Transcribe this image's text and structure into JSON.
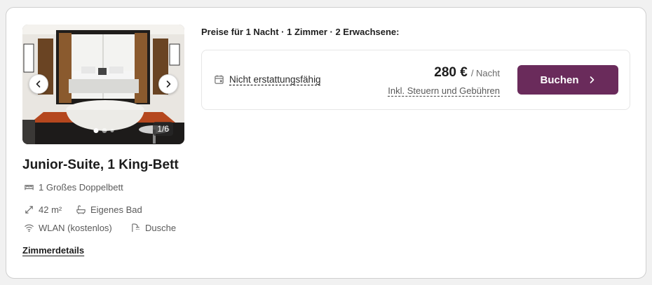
{
  "room": {
    "title": "Junior-Suite, 1 King-Bett",
    "bed": "1 Großes Doppelbett",
    "size": "42 m²",
    "bath": "Eigenes Bad",
    "wifi": "WLAN (kostenlos)",
    "shower": "Dusche",
    "details_link": "Zimmerdetails"
  },
  "carousel": {
    "counter": "1/6",
    "prev_icon": "chevron-left-icon",
    "next_icon": "chevron-right-icon"
  },
  "pricing": {
    "heading": "Preise für 1 Nacht · 1 Zimmer · 2 Erwachsene:",
    "refund_policy": "Nicht erstattungsfähig",
    "amount": "280 €",
    "per_night": "/ Nacht",
    "taxes_note": "Inkl. Steuern und Gebühren",
    "book_label": "Buchen"
  },
  "colors": {
    "book_button": "#6a2b5b"
  }
}
